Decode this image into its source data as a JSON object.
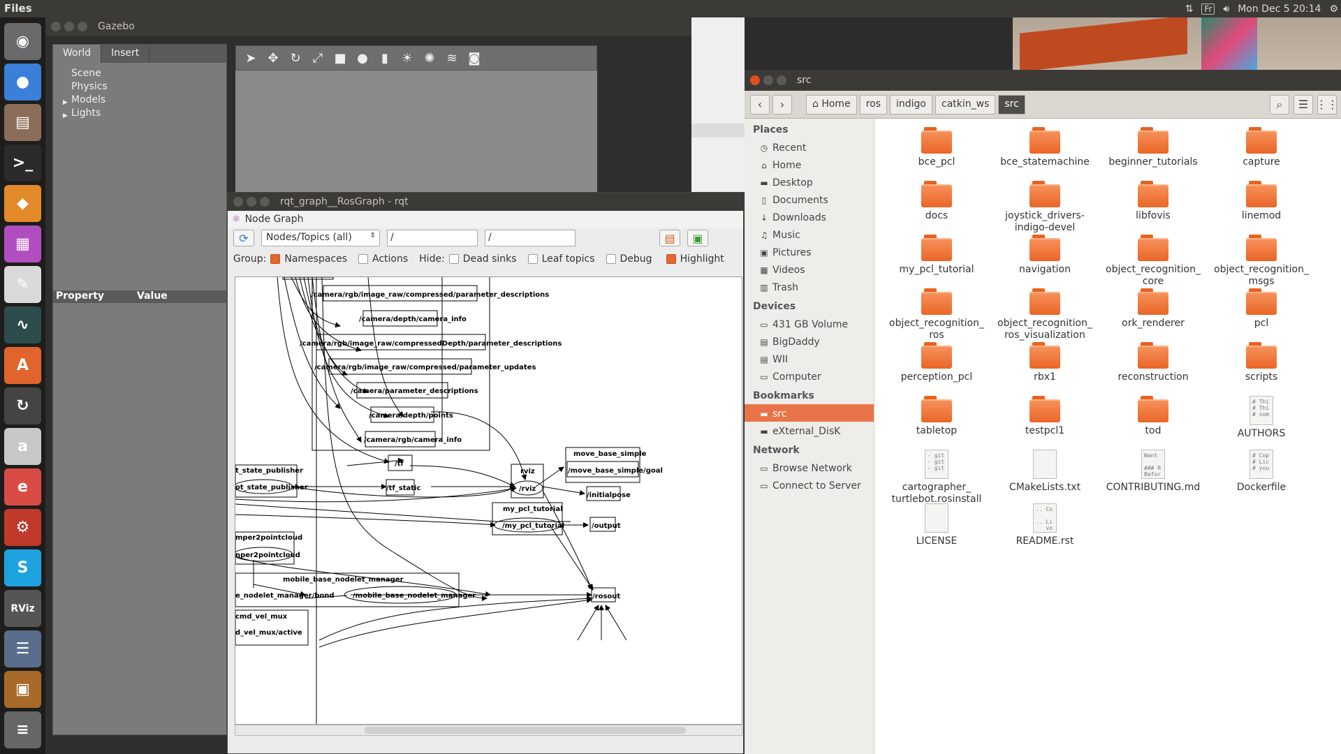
{
  "top_panel": {
    "app_name": "Files",
    "keyboard": "Fr",
    "clock": "Mon Dec  5 20:14"
  },
  "launcher": {
    "items": [
      {
        "name": "dash",
        "color": "#6a6a6a",
        "glyph": "◉"
      },
      {
        "name": "chrome",
        "color": "#3a7fd8",
        "glyph": "●"
      },
      {
        "name": "files",
        "color": "#8b6e5a",
        "glyph": "▤"
      },
      {
        "name": "terminal",
        "color": "#2b2b2b",
        "glyph": ">_"
      },
      {
        "name": "sublime",
        "color": "#e38a2a",
        "glyph": "◆"
      },
      {
        "name": "workspaces",
        "color": "#b04dbf",
        "glyph": "▦"
      },
      {
        "name": "text-editor",
        "color": "#dadada",
        "glyph": "✎"
      },
      {
        "name": "system-monitor",
        "color": "#2d4d4d",
        "glyph": "∿"
      },
      {
        "name": "software",
        "color": "#e0642c",
        "glyph": "A"
      },
      {
        "name": "updater",
        "color": "#444",
        "glyph": "↻"
      },
      {
        "name": "amazon",
        "color": "#c8c8c8",
        "glyph": "a"
      },
      {
        "name": "evince",
        "color": "#d94c45",
        "glyph": "e"
      },
      {
        "name": "settings",
        "color": "#c0392b",
        "glyph": "⚙"
      },
      {
        "name": "skype",
        "color": "#1fa3e0",
        "glyph": "S"
      },
      {
        "name": "rviz",
        "color": "#555",
        "glyph": "RViz"
      },
      {
        "name": "stack",
        "color": "#5a6d8a",
        "glyph": "☰"
      },
      {
        "name": "stack2",
        "color": "#a86a2a",
        "glyph": "▣"
      },
      {
        "name": "trash",
        "color": "#666",
        "glyph": "≡"
      }
    ]
  },
  "gazebo": {
    "title": "Gazebo",
    "tabs": [
      "World",
      "Insert"
    ],
    "tree": [
      "Scene",
      "Physics",
      "Models",
      "Lights"
    ],
    "property_header": "Property",
    "value_header": "Value"
  },
  "rqt": {
    "title": "rqt_graph__RosGraph - rqt",
    "plugin_title": "Node Graph",
    "combo_value": "Nodes/Topics (all)",
    "filter1": "/",
    "filter2": "/",
    "group_label": "Group:",
    "namespaces": "Namespaces",
    "actions": "Actions",
    "hide_label": "Hide:",
    "dead_sinks": "Dead sinks",
    "leaf_topics": "Leaf topics",
    "debug": "Debug",
    "highlight": "Highlight"
  },
  "graph": {
    "topics": [
      "/camera/rgb/image_raw/compressed/parameter_descriptions",
      "/camera/depth/camera_info",
      "/camera/rgb/image_raw/compressedDepth/parameter_descriptions",
      "/camera/rgb/image_raw/compressed/parameter_updates",
      "/camera/parameter_descriptions",
      "/camera/depth/points",
      "/camera/rgb/camera_info",
      "/tf",
      "/tf_static",
      "/initialpose",
      "/output",
      "/rosout",
      "/move_base_simple/goal",
      "e_nodelet_manager/bond",
      "d_vel_mux/active"
    ],
    "nodes": [
      "/rviz",
      "/my_pcl_tutorial",
      "ot_state_publisher",
      "nper2pointcloud",
      "/mobile_base_nodelet_manager"
    ],
    "groups": [
      "rviz",
      "move_base_simple",
      "my_pcl_tutorial",
      "t_state_publisher",
      "mper2pointcloud",
      "mobile_base_nodelet_manager",
      "cmd_vel_mux"
    ]
  },
  "files": {
    "window_title": "src",
    "breadcrumbs": [
      "Home",
      "ros",
      "indigo",
      "catkin_ws",
      "src"
    ],
    "sidebar": {
      "places_head": "Places",
      "places": [
        {
          "label": "Recent",
          "icon": "clock-icon",
          "glyph": "◷"
        },
        {
          "label": "Home",
          "icon": "home-icon",
          "glyph": "⌂"
        },
        {
          "label": "Desktop",
          "icon": "folder-icon",
          "glyph": "▬"
        },
        {
          "label": "Documents",
          "icon": "document-icon",
          "glyph": "▯"
        },
        {
          "label": "Downloads",
          "icon": "download-icon",
          "glyph": "↓"
        },
        {
          "label": "Music",
          "icon": "music-icon",
          "glyph": "♫"
        },
        {
          "label": "Pictures",
          "icon": "picture-icon",
          "glyph": "▣"
        },
        {
          "label": "Videos",
          "icon": "video-icon",
          "glyph": "▦"
        },
        {
          "label": "Trash",
          "icon": "trash-icon",
          "glyph": "▥"
        }
      ],
      "devices_head": "Devices",
      "devices": [
        {
          "label": "431 GB Volume",
          "icon": "drive-icon",
          "glyph": "▭"
        },
        {
          "label": "BigDaddy",
          "icon": "drive-icon",
          "glyph": "▤"
        },
        {
          "label": "WII",
          "icon": "drive-icon",
          "glyph": "▤"
        },
        {
          "label": "Computer",
          "icon": "computer-icon",
          "glyph": "▭"
        }
      ],
      "bookmarks_head": "Bookmarks",
      "bookmarks": [
        {
          "label": "src",
          "icon": "folder-icon",
          "glyph": "▬"
        },
        {
          "label": "eXternal_DisK",
          "icon": "folder-icon",
          "glyph": "▬"
        }
      ],
      "network_head": "Network",
      "network": [
        {
          "label": "Browse Network",
          "icon": "network-icon",
          "glyph": "▭"
        },
        {
          "label": "Connect to Server",
          "icon": "server-icon",
          "glyph": "▭"
        }
      ]
    },
    "items": [
      {
        "label": "bce_pcl",
        "type": "folder"
      },
      {
        "label": "bce_statemachine",
        "type": "folder"
      },
      {
        "label": "beginner_tutorials",
        "type": "folder"
      },
      {
        "label": "capture",
        "type": "folder"
      },
      {
        "label": "docs",
        "type": "folder"
      },
      {
        "label": "joystick_drivers-\nindigo-devel",
        "type": "folder"
      },
      {
        "label": "libfovis",
        "type": "folder"
      },
      {
        "label": "linemod",
        "type": "folder"
      },
      {
        "label": "my_pcl_tutorial",
        "type": "folder"
      },
      {
        "label": "navigation",
        "type": "folder"
      },
      {
        "label": "object_recognition_\ncore",
        "type": "folder"
      },
      {
        "label": "object_recognition_\nmsgs",
        "type": "folder"
      },
      {
        "label": "object_recognition_\nros",
        "type": "folder"
      },
      {
        "label": "object_recognition_\nros_visualization",
        "type": "folder"
      },
      {
        "label": "ork_renderer",
        "type": "folder"
      },
      {
        "label": "pcl",
        "type": "folder"
      },
      {
        "label": "perception_pcl",
        "type": "folder"
      },
      {
        "label": "rbx1",
        "type": "folder"
      },
      {
        "label": "reconstruction",
        "type": "folder"
      },
      {
        "label": "scripts",
        "type": "folder"
      },
      {
        "label": "tabletop",
        "type": "folder"
      },
      {
        "label": "testpcl1",
        "type": "folder"
      },
      {
        "label": "tod",
        "type": "folder"
      },
      {
        "label": "AUTHORS",
        "type": "text",
        "preview": "# Thi\n# Thi\n# som"
      },
      {
        "label": "cartographer_\nturtlebot.rosinstall",
        "type": "text",
        "preview": "- git\n- git\n- git"
      },
      {
        "label": "CMakeLists.txt",
        "type": "text",
        "preview": ""
      },
      {
        "label": "CONTRIBUTING.md",
        "type": "text",
        "preview": "Want\n\n### R\nBefor"
      },
      {
        "label": "Dockerfile",
        "type": "text",
        "preview": "# Cop\n# Lic\n# you"
      },
      {
        "label": "LICENSE",
        "type": "text",
        "preview": ""
      },
      {
        "label": "README.rst",
        "type": "text",
        "preview": ".. Co\n\n.. Li\n   vo"
      }
    ]
  }
}
